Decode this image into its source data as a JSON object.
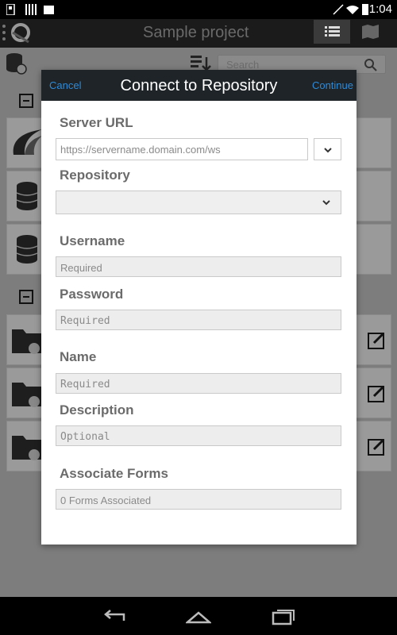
{
  "status_bar": {
    "time": "1:04"
  },
  "action_bar": {
    "title": "Sample project"
  },
  "background": {
    "search_placeholder": "Search"
  },
  "dialog": {
    "cancel_label": "Cancel",
    "title": "Connect to Repository",
    "continue_label": "Continue",
    "server_url": {
      "label": "Server URL",
      "placeholder": "https://servername.domain.com/ws"
    },
    "repository": {
      "label": "Repository",
      "value": ""
    },
    "username": {
      "label": "Username",
      "placeholder": "Required"
    },
    "password": {
      "label": "Password",
      "placeholder": "Required"
    },
    "name": {
      "label": "Name",
      "placeholder": "Required"
    },
    "description": {
      "label": "Description",
      "placeholder": "Optional"
    },
    "associate_forms": {
      "label": "Associate Forms",
      "value": "0 Forms Associated"
    }
  },
  "colors": {
    "accent": "#2d8bd8",
    "header": "#1e2428",
    "label": "#6b6b6b"
  }
}
